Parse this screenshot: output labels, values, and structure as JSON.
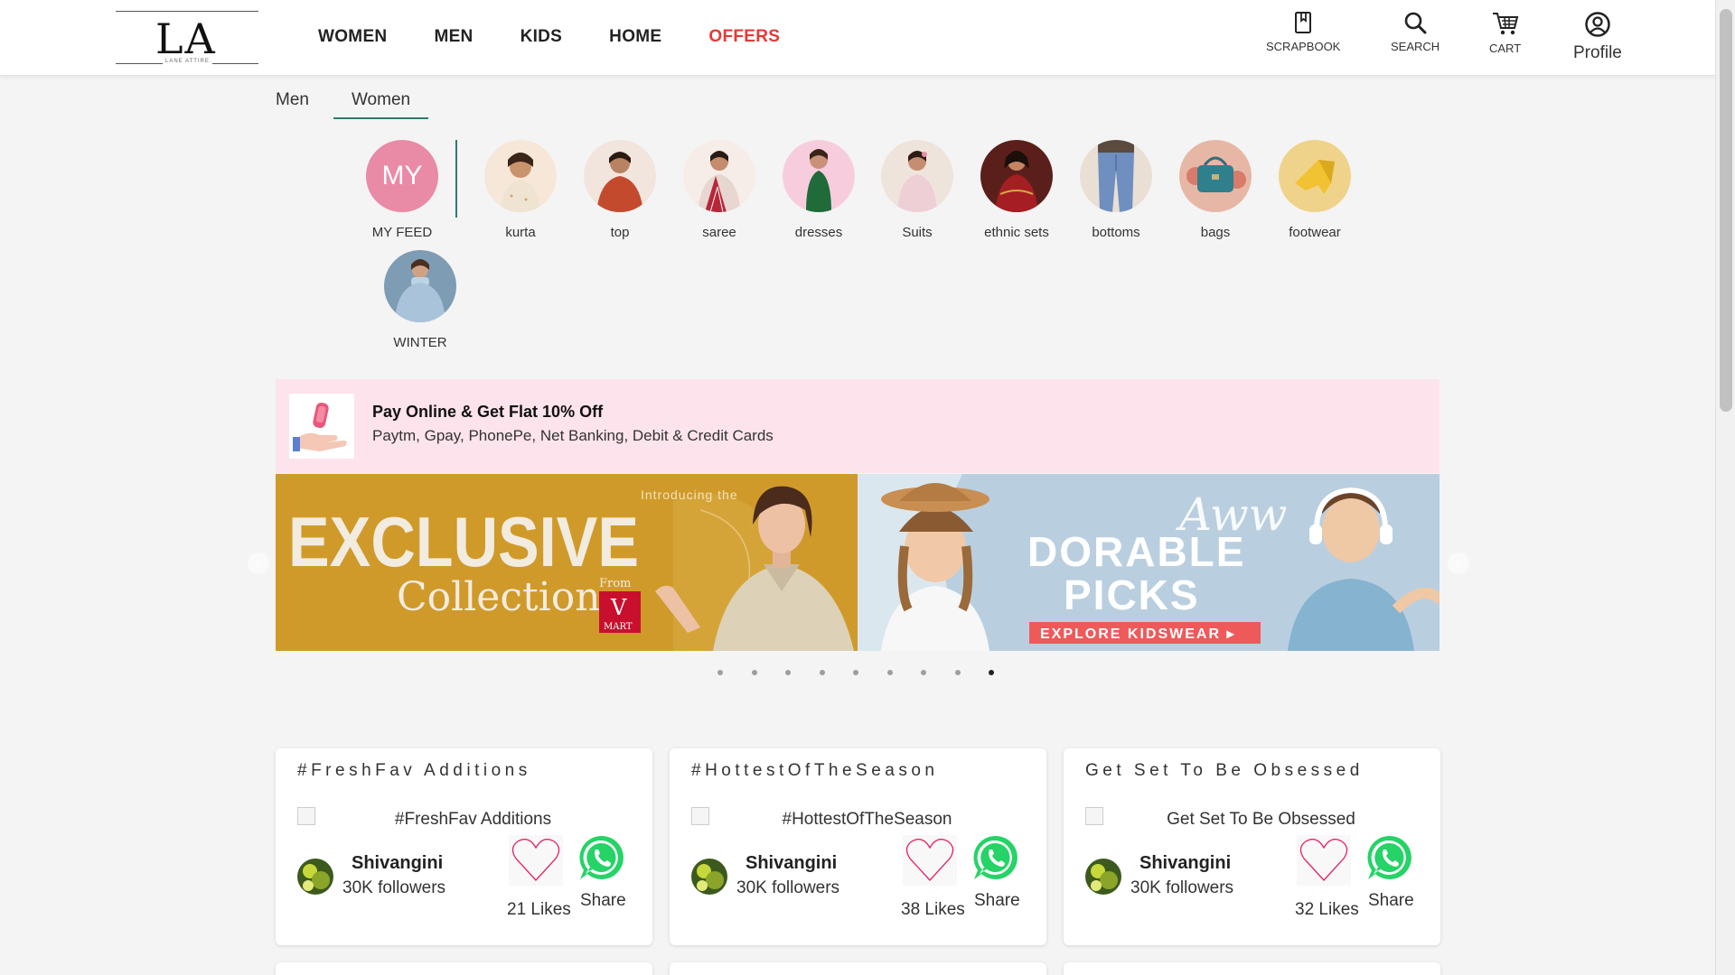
{
  "header": {
    "logo_mark": "LA",
    "logo_tagline": "LANE ATTIRE",
    "nav": [
      "WOMEN",
      "MEN",
      "KIDS",
      "HOME",
      "OFFERS"
    ],
    "icons": {
      "scrapbook": "SCRAPBOOK",
      "search": "SEARCH",
      "cart": "CART",
      "profile": "Profile"
    }
  },
  "gender_tabs": [
    "Men",
    "Women"
  ],
  "active_gender_tab": "Women",
  "categories": {
    "feed": {
      "initials": "MY",
      "label": "MY FEED"
    },
    "items": [
      "kurta",
      "top",
      "saree",
      "dresses",
      "Suits",
      "ethnic sets",
      "bottoms",
      "bags",
      "footwear",
      "WINTER"
    ]
  },
  "offer": {
    "title": "Pay Online & Get Flat 10% Off",
    "subtitle": "Paytm, Gpay, PhonePe, Net Banking, Debit & Credit Cards"
  },
  "banner": {
    "left": {
      "intro": "Introducing the",
      "headline": "EXCLUSIVE",
      "collection": "Collection",
      "from": "From",
      "brand_v": "V",
      "brand_mart": "MART"
    },
    "right": {
      "script": "Aww",
      "line1": "DORABLE",
      "line2": "PICKS",
      "cta": "EXPLORE KIDSWEAR ▸"
    },
    "slide_count": 9,
    "active_slide": 9
  },
  "cards": [
    {
      "title": "#FreshFav Additions",
      "image_alt": "#FreshFav Additions",
      "user": "Shivangini",
      "followers": "30K followers",
      "likes": "21 Likes",
      "share": "Share"
    },
    {
      "title": "#HottestOfTheSeason",
      "image_alt": "#HottestOfTheSeason",
      "user": "Shivangini",
      "followers": "30K followers",
      "likes": "38 Likes",
      "share": "Share"
    },
    {
      "title": "Get Set To Be Obsessed",
      "image_alt": "Get Set To Be Obsessed",
      "user": "Shivangini",
      "followers": "30K followers",
      "likes": "32 Likes",
      "share": "Share"
    }
  ],
  "colors": {
    "offers_red": "#e53935",
    "accent_green": "#2e7d6e",
    "feed_pink": "#e98aa7",
    "offer_bg": "#fde3ec",
    "whatsapp_green": "#25d366",
    "heart_pink": "#e91e63",
    "banner_mustard": "#d09a2a",
    "banner_blue": "#b9cfe0"
  }
}
